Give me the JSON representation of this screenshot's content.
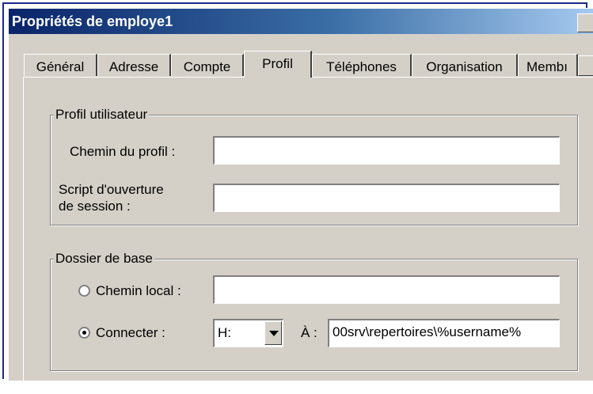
{
  "window": {
    "title": "Propriétés de employe1"
  },
  "tabs": [
    {
      "label": "Général"
    },
    {
      "label": "Adresse"
    },
    {
      "label": "Compte"
    },
    {
      "label": "Profil"
    },
    {
      "label": "Téléphones"
    },
    {
      "label": "Organisation"
    },
    {
      "label": "Membı"
    }
  ],
  "profile_group": {
    "legend": "Profil utilisateur",
    "profile_path_label": "Chemin du profil :",
    "profile_path_value": "",
    "logon_script_label_line1": "Script d'ouverture",
    "logon_script_label_line2": "de session :",
    "logon_script_value": ""
  },
  "home_group": {
    "legend": "Dossier de base",
    "local_path_label": "Chemin local :",
    "local_path_value": "",
    "connect_label": "Connecter :",
    "drive_value": "H:",
    "to_label": "À :",
    "unc_value": "00srv\\repertoires\\%username%",
    "selected_option": "connect"
  }
}
